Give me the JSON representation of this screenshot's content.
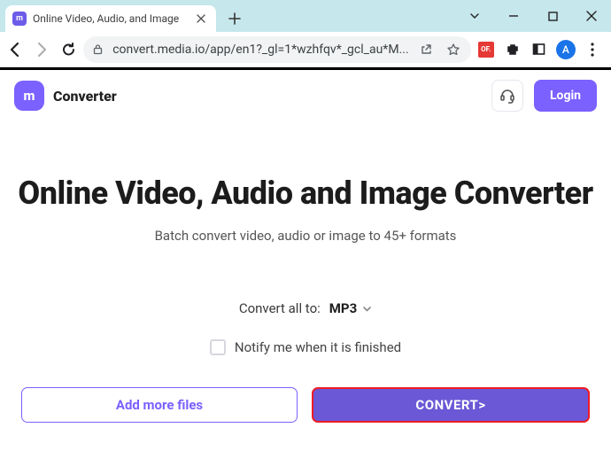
{
  "browser": {
    "tab_title": "Online Video, Audio, and Image",
    "url": "convert.media.io/app/en1?_gl=1*wzhfqv*_gcl_au*M...",
    "ext_badge": "OF.",
    "avatar_letter": "A"
  },
  "header": {
    "brand_mark": "m",
    "brand_label": "Converter",
    "login_label": "Login"
  },
  "hero": {
    "title": "Online Video, Audio and Image Converter",
    "subtitle": "Batch convert video, audio or image to 45+ formats"
  },
  "panel": {
    "convert_label": "Convert all to:",
    "format": "MP3",
    "notify_label": "Notify me when it is finished",
    "add_more_label": "Add more files",
    "convert_button_label": "CONVERT>"
  }
}
